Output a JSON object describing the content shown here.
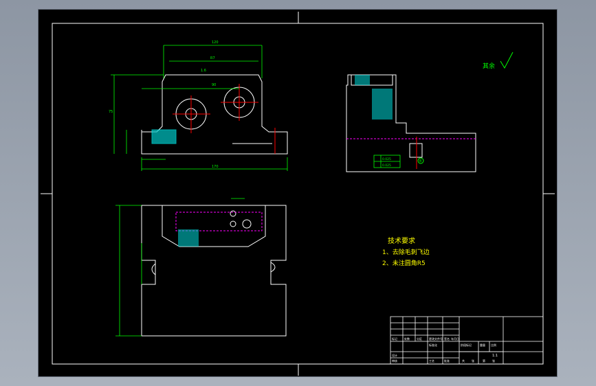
{
  "drawing": {
    "roughness_mark": "其余",
    "technical_requirements": {
      "title": "技术要求",
      "items": [
        "1、去除毛刺飞边",
        "2、未注圆角R5"
      ]
    },
    "front_view": {
      "dim_top": "120",
      "dim_inner": "R7",
      "dim_upper": "90",
      "dim_height": "75",
      "dim_bottom": "170",
      "roughness_value": "1.6"
    },
    "side_view": {
      "tolerance_rows": [
        "0.025",
        "0.025"
      ],
      "datum": "B"
    },
    "title_block": {
      "labels": [
        "标记",
        "处数",
        "分区",
        "更改文件号",
        "签名",
        "年月日",
        "设计",
        "标准化",
        "阶段标记",
        "重量",
        "比例",
        "审核",
        "工艺",
        "批准",
        "共",
        "张",
        "第",
        "张"
      ],
      "scale": "1:1"
    }
  },
  "colors": {
    "outline": "#ffffff",
    "dimension": "#00ff00",
    "centerline": "#ff0000",
    "hidden": "#ff00ff",
    "section": "#00ffff",
    "text": "#ffff00"
  }
}
